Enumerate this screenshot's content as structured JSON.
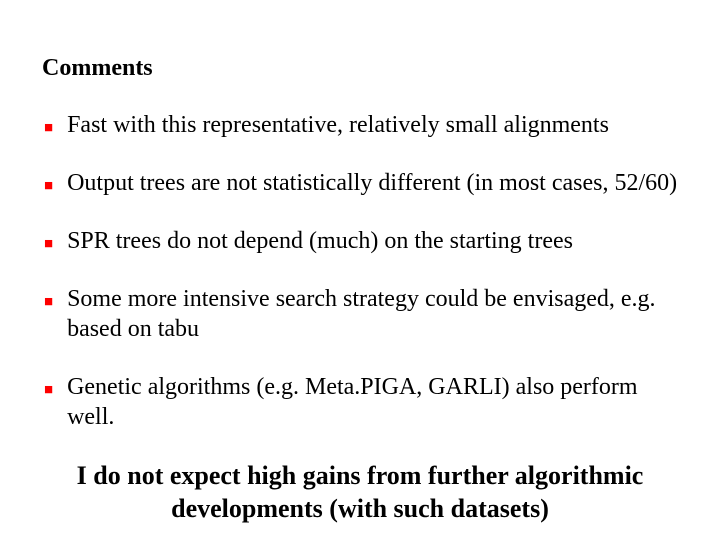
{
  "title": "Comments",
  "bullets": [
    "Fast with this representative, relatively small alignments",
    "Output trees are not statistically different (in most cases, 52/60)",
    "SPR trees do not depend (much) on the starting trees",
    "Some more intensive search strategy could be envisaged, e.g. based on tabu",
    "Genetic algorithms (e.g. Meta.PIGA, GARLI) also perform well."
  ],
  "closing": "I do not expect high gains from further algorithmic developments (with such datasets)"
}
